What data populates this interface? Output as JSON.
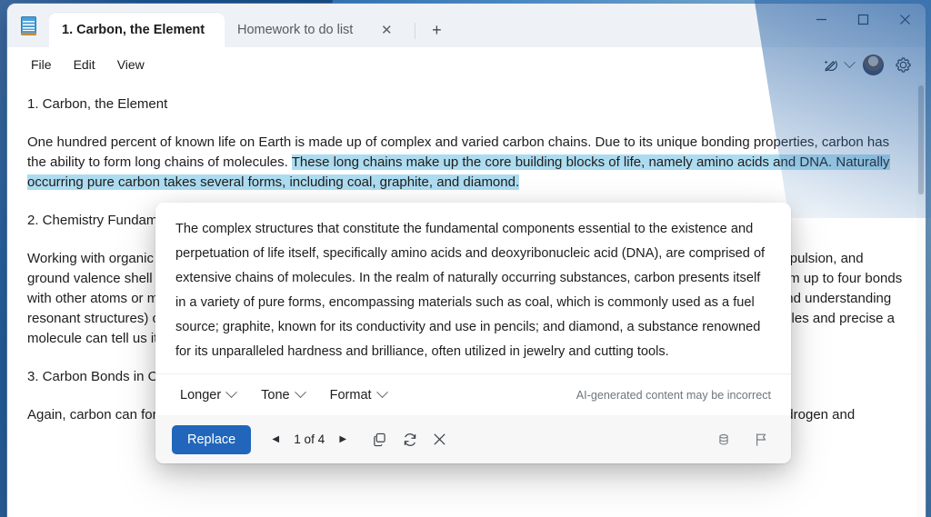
{
  "window": {
    "app_icon": "notepad-icon",
    "tabs": [
      {
        "label": "1. Carbon, the Element",
        "active": true
      },
      {
        "label": "Homework to do list",
        "active": false
      }
    ],
    "new_tab_label": "+",
    "tab_close_label": "✕",
    "controls": {
      "minimize": "minimize-icon",
      "maximize": "maximize-icon",
      "close": "close-icon"
    }
  },
  "menubar": {
    "items": [
      "File",
      "Edit",
      "View"
    ],
    "right_tools": {
      "copilot": "ai-pen-icon",
      "copilot_chevron": "chevron-down-icon",
      "account": "avatar",
      "settings": "gear-icon"
    }
  },
  "document": {
    "heading1": "1. Carbon, the Element",
    "para1_plain": "One hundred percent of known life on Earth is made up of complex and varied carbon chains. Due to its unique bonding properties, carbon has the ability to form long chains of molecules. ",
    "para1_highlight": "These long chains make up the core building blocks of life, namely amino acids and DNA. Naturally occurring pure carbon takes several forms, including coal, graphite, and diamond.",
    "heading2": "2. Chemistry Fundamentals",
    "para2": "Working with organic chemistry, it may be helpful to provide a brief review of valence shell theory, valence shell electron pair repulsion, and ground valence shell theory—the idea that carbon is uniquely suited due to the four electrons in its outer shell, allowing it to form up to four bonds with other atoms or molecules. Understanding hybridization and Lewis dot structures play a pivotal role in organic chemistry, and understanding resonant structures) can help explain bonding. Molecular and orbital shells can help illuminate the eventual shape, and the angles and precise a molecule can tell us its basic shape.",
    "heading3": "3. Carbon Bonds in Organic Chemistry",
    "para3": "Again, carbon can form up to four bonds with other molecules. In organic chemistry, we mainly focus on carbon chains with hydrogen and"
  },
  "ai_popup": {
    "generated_text": "The complex structures that constitute the fundamental components essential to the existence and perpetuation of life itself, specifically amino acids and deoxyribonucleic acid (DNA), are comprised of extensive chains of molecules. In the realm of naturally occurring substances, carbon presents itself in a variety of pure forms, encompassing materials such as coal, which is commonly used as a fuel source; graphite, known for its conductivity and use in pencils; and diamond, a substance renowned for its unparalleled hardness and brilliance, often utilized in jewelry and cutting tools.",
    "tools": [
      {
        "label": "Longer",
        "icon": "chevron-down-icon"
      },
      {
        "label": "Tone",
        "icon": "chevron-down-icon"
      },
      {
        "label": "Format",
        "icon": "chevron-down-icon"
      }
    ],
    "disclaimer": "AI-generated content may be incorrect",
    "actions": {
      "replace_label": "Replace",
      "prev_label": "◀",
      "next_label": "▶",
      "counter": "1 of 4",
      "copy_icon": "copy-icon",
      "regenerate_icon": "refresh-icon",
      "dismiss_icon": "close-icon",
      "stack_icon": "database-stack-icon",
      "flag_icon": "flag-icon"
    }
  },
  "colors": {
    "accent": "#2266bb",
    "highlight": "#addcf0",
    "titlebar": "#eef2f6",
    "popup_footer": "#f7f7f8"
  }
}
